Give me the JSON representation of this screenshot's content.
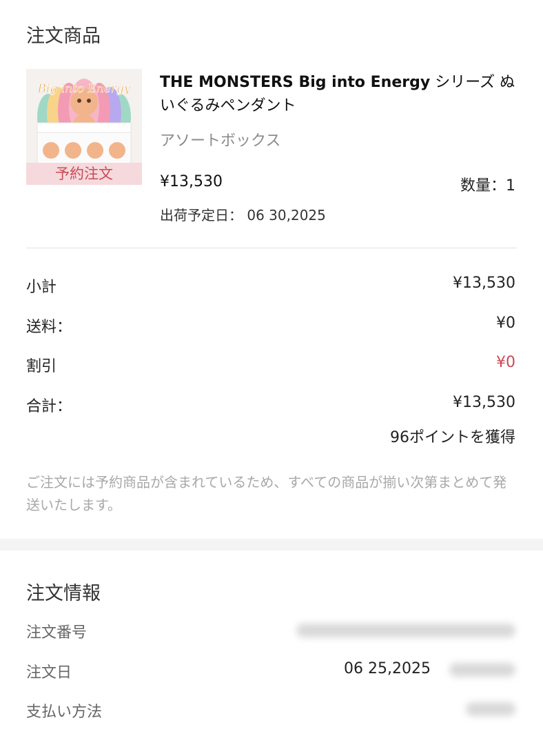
{
  "order_items": {
    "title": "注文商品",
    "product": {
      "name_en": "THE MONSTERS Big into Energy",
      "name_jp": " シリーズ ぬいぐるみペンダント",
      "variant": "アソートボックス",
      "price": "¥13,530",
      "quantity": "数量：1",
      "ship_label": "出荷予定日：",
      "ship_date": "06 30,2025",
      "badge": "予約注文",
      "image_title": "Big into Energy"
    }
  },
  "summary": {
    "subtotal_label": "小計",
    "subtotal_value": "¥13,530",
    "shipping_label": "送料：",
    "shipping_value": "¥0",
    "discount_label": "割引",
    "discount_value": "¥0",
    "total_label": "合計：",
    "total_value": "¥13,530",
    "points": "96ポイントを獲得",
    "note": "ご注文には予約商品が含まれているため、すべての商品が揃い次第まとめて発送いたします。"
  },
  "order_info": {
    "title": "注文情報",
    "order_number_label": "注文番号",
    "order_date_label": "注文日",
    "order_date_value": "06 25,2025",
    "payment_label": "支払い方法"
  },
  "colors": {
    "accent_red": "#c94a57",
    "badge_bg": "#f6d9dc",
    "muted_text": "#a8a8a8"
  }
}
